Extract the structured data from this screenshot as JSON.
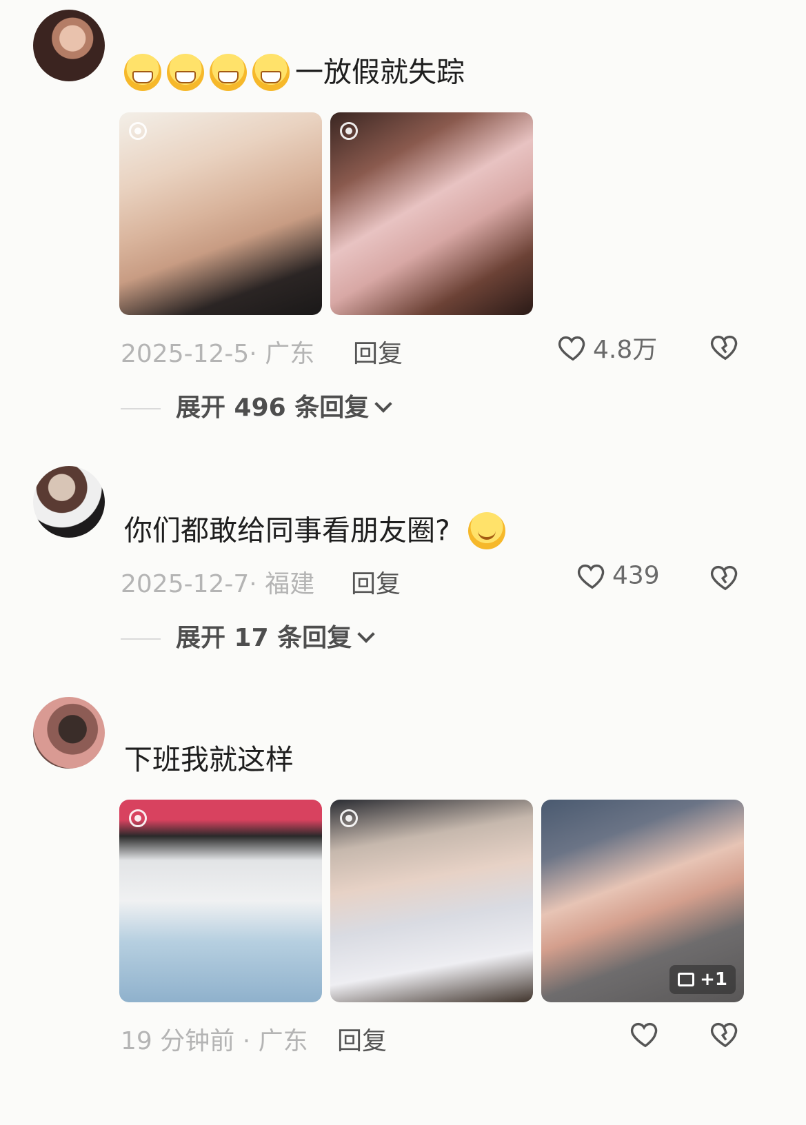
{
  "comments": [
    {
      "text": "一放假就失踪",
      "emoji_count": 4,
      "meta": "2025-12-5· 广东",
      "reply": "回复",
      "likes": "4.8万",
      "expand": "展开 496 条回复"
    },
    {
      "text": "你们都敢给同事看朋友圈?",
      "meta": "2025-12-7· 福建",
      "reply": "回复",
      "likes": "439",
      "expand": "展开 17 条回复"
    },
    {
      "text": "下班我就这样",
      "meta": "19 分钟前 · 广东",
      "reply": "回复",
      "likes": "",
      "more_images": "+1"
    }
  ],
  "icons": {
    "like": "heart-icon",
    "dislike": "broken-heart-icon",
    "live_photo": "live-photo-icon",
    "expand": "chevron-down-icon",
    "image_count": "image-icon"
  }
}
